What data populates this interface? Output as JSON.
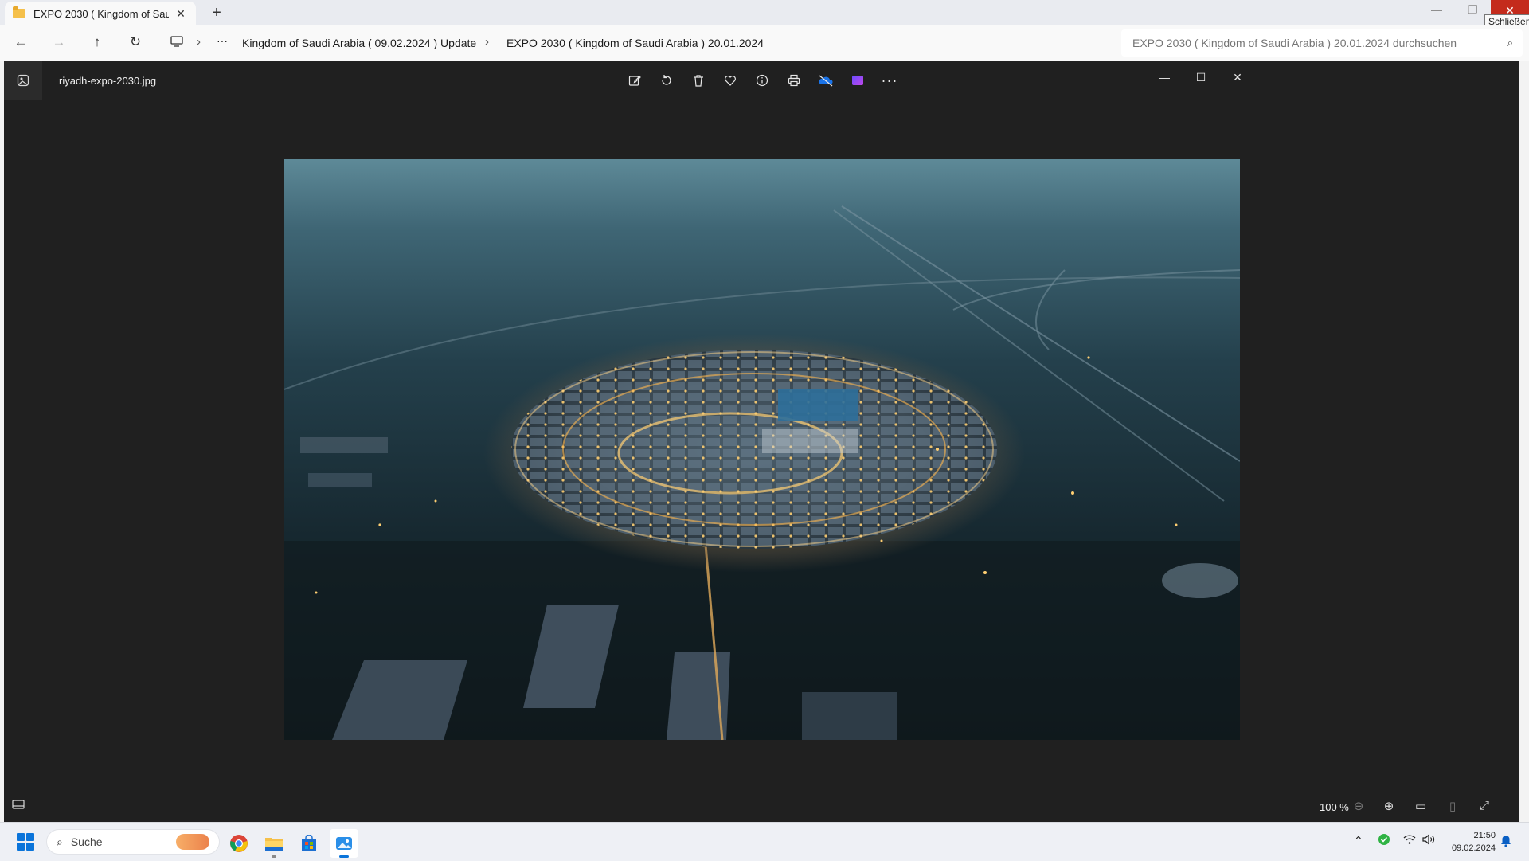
{
  "explorer": {
    "tab_title": "EXPO 2030 ( Kingdom of Saud",
    "tooltip": "Schließen",
    "breadcrumb": [
      "Kingdom of Saudi Arabia ( 09.02.2024 ) Update",
      "EXPO 2030 ( Kingdom of Saudi Arabia ) 20.01.2024"
    ],
    "search_placeholder": "EXPO 2030 ( Kingdom of Saudi Arabia ) 20.01.2024 durchsuchen"
  },
  "viewer": {
    "filename": "riyadh-expo-2030.jpg",
    "toolbar_icons": [
      "edit-image-icon",
      "rotate-icon",
      "delete-icon",
      "favorite-icon",
      "info-icon",
      "print-icon",
      "onedrive-icon",
      "clipchamp-icon",
      "more-icon"
    ],
    "zoom_label": "100 %"
  },
  "taskbar": {
    "search_text": "Suche",
    "time": "21:50",
    "date": "09.02.2024",
    "apps": [
      "chrome-icon",
      "file-explorer-icon",
      "microsoft-store-icon",
      "photos-icon"
    ]
  },
  "colors": {
    "accent": "#0a74da",
    "close_red": "#c42b1c",
    "viewer_bg": "#202020"
  }
}
